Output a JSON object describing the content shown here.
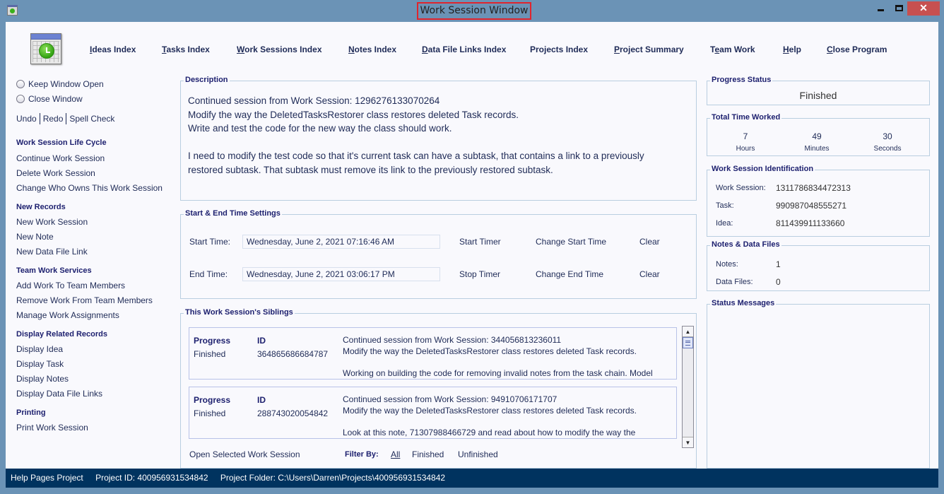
{
  "window": {
    "title": "Work Session Window",
    "minimize_label": "_",
    "maximize_label": "□",
    "close_label": "✕"
  },
  "nav": [
    {
      "label": "Ideas Index",
      "mnemonic": "I"
    },
    {
      "label": "Tasks Index",
      "mnemonic": "T"
    },
    {
      "label": "Work Sessions Index",
      "mnemonic": "W"
    },
    {
      "label": "Notes Index",
      "mnemonic": "N"
    },
    {
      "label": "Data File Links Index",
      "mnemonic": "D"
    },
    {
      "label": "Projects Index",
      "mnemonic": ""
    },
    {
      "label": "Project Summary",
      "mnemonic": "P"
    },
    {
      "label": "Team Work",
      "mnemonic": "e"
    },
    {
      "label": "Help",
      "mnemonic": "H"
    },
    {
      "label": "Close Program",
      "mnemonic": "C"
    }
  ],
  "sidebar": {
    "keep_window_open": "Keep Window Open",
    "close_window": "Close Window",
    "undo": "Undo",
    "redo": "Redo",
    "spell_check": "Spell Check",
    "sections": [
      {
        "heading": "Work Session Life Cycle",
        "items": [
          "Continue Work Session",
          "Delete Work Session",
          "Change Who Owns This Work Session"
        ]
      },
      {
        "heading": "New Records",
        "items": [
          "New Work Session",
          "New Note",
          "New Data File Link"
        ]
      },
      {
        "heading": "Team Work Services",
        "items": [
          "Add Work To Team Members",
          "Remove Work From Team Members",
          "Manage Work Assignments"
        ]
      },
      {
        "heading": "Display Related Records",
        "items": [
          "Display Idea",
          "Display Task",
          "Display Notes",
          "Display Data File Links"
        ]
      },
      {
        "heading": "Printing",
        "items": [
          "Print Work Session"
        ]
      }
    ]
  },
  "description": {
    "title": "Description",
    "text": "Continued session from Work Session: 1296276133070264\nModify the way the DeletedTasksRestorer class restores deleted Task records.\nWrite and test the code for the new way the class should work.\n\nI need to modify the test code so that it's current task can have a subtask, that contains a link to a previously\nrestored subtask. That subtask must remove its link to the previously restored subtask."
  },
  "times": {
    "title": "Start & End Time Settings",
    "start_label": "Start Time:",
    "start_value": "Wednesday, June 2, 2021   07:16:46 AM",
    "start_timer": "Start Timer",
    "change_start": "Change Start Time",
    "clear": "Clear",
    "end_label": "End Time:",
    "end_value": "Wednesday, June 2, 2021   03:06:17 PM",
    "stop_timer": "Stop Timer",
    "change_end": "Change End Time"
  },
  "siblings": {
    "title": "This Work Session's Siblings",
    "progress_header": "Progress",
    "id_header": "ID",
    "items": [
      {
        "progress": "Finished",
        "id": "364865686684787",
        "description": "Continued session from Work Session: 344056813236011\nModify the way the DeletedTasksRestorer class restores deleted Task records.\n\nWorking on building the code for removing invalid notes from the task chain. Model"
      },
      {
        "progress": "Finished",
        "id": "288743020054842",
        "description": "Continued session from Work Session: 94910706171707\nModify the way the DeletedTasksRestorer class restores deleted Task records.\n\nLook at this note, 71307988466729 and read about how to modify the way the"
      }
    ],
    "open_selected": "Open Selected Work Session",
    "filter_label": "Filter By:",
    "filter_all": "All",
    "filter_finished": "Finished",
    "filter_unfinished": "Unfinished",
    "scroll_up_icon": "▲",
    "scroll_down_icon": "▼"
  },
  "progress_status": {
    "title": "Progress Status",
    "value": "Finished"
  },
  "total_time": {
    "title": "Total Time Worked",
    "hours": "7",
    "hours_label": "Hours",
    "minutes": "49",
    "minutes_label": "Minutes",
    "seconds": "30",
    "seconds_label": "Seconds"
  },
  "identification": {
    "title": "Work Session Identification",
    "work_session_label": "Work Session:",
    "work_session": "1311786834472313",
    "task_label": "Task:",
    "task": "990987048555271",
    "idea_label": "Idea:",
    "idea": "811439911133660"
  },
  "notes_files": {
    "title": "Notes & Data Files",
    "notes_label": "Notes:",
    "notes": "1",
    "data_files_label": "Data Files:",
    "data_files": "0"
  },
  "status_messages": {
    "title": "Status Messages"
  },
  "statusbar": {
    "project_name": "Help Pages Project",
    "project_id": "Project ID:  400956931534842",
    "project_folder": "Project Folder: C:\\Users\\Darren\\Projects\\400956931534842"
  }
}
